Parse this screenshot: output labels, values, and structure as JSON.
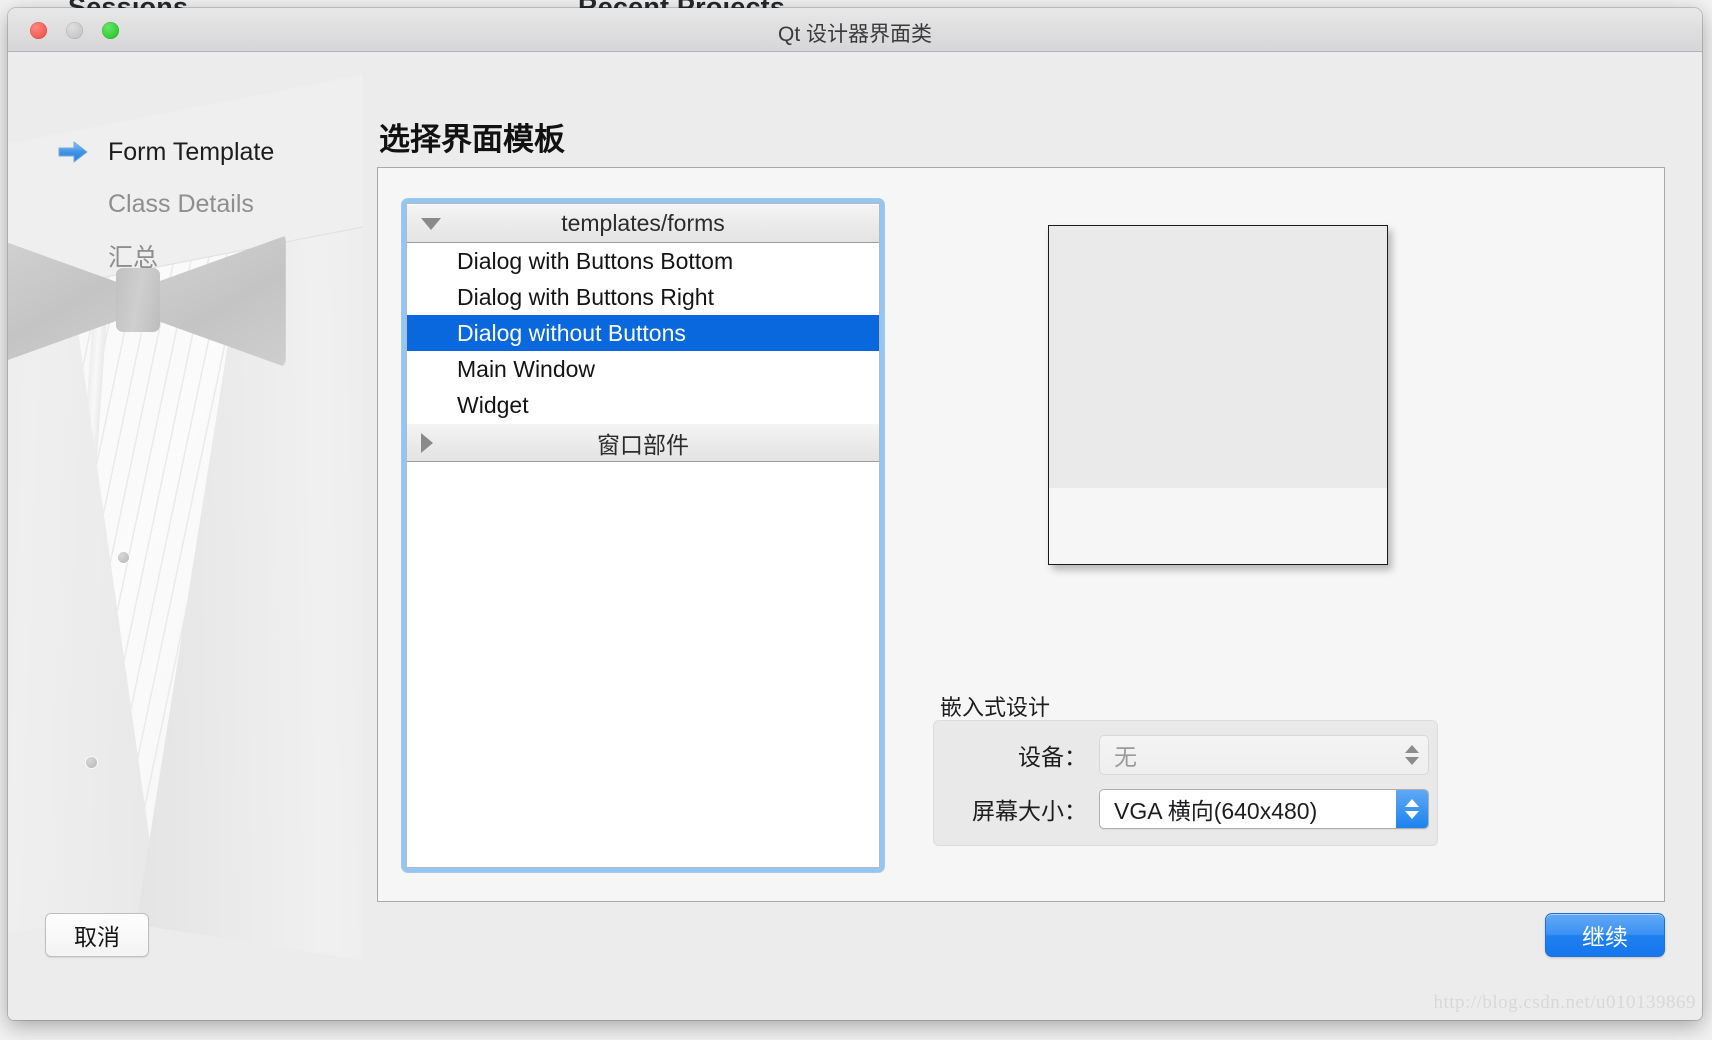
{
  "backdrop": {
    "left_heading": "Sessions",
    "right_heading": "Recent Projects"
  },
  "window": {
    "title": "Qt 设计器界面类",
    "traffic_lights": {
      "close": "close-button",
      "minimize": "minimize-button",
      "maximize": "maximize-button"
    }
  },
  "sidebar": {
    "steps": [
      {
        "label": "Form Template",
        "active": true
      },
      {
        "label": "Class Details",
        "active": false
      },
      {
        "label": "汇总",
        "active": false
      }
    ]
  },
  "page": {
    "title": "选择界面模板"
  },
  "template_list": {
    "groups": [
      {
        "name": "templates/forms",
        "expanded": true,
        "items": [
          {
            "label": "Dialog with Buttons Bottom",
            "selected": false
          },
          {
            "label": "Dialog with Buttons Right",
            "selected": false
          },
          {
            "label": "Dialog without Buttons",
            "selected": true
          },
          {
            "label": "Main Window",
            "selected": false
          },
          {
            "label": "Widget",
            "selected": false
          }
        ]
      },
      {
        "name": "窗口部件",
        "expanded": false,
        "items": []
      }
    ]
  },
  "preview": {
    "caption": "form-preview"
  },
  "embedded_design": {
    "group_label": "嵌入式设计",
    "device": {
      "label": "设备：",
      "value": "无",
      "enabled": false
    },
    "screen_size": {
      "label": "屏幕大小：",
      "value": "VGA 横向(640x480)",
      "enabled": true
    }
  },
  "footer": {
    "cancel_label": "取消",
    "continue_label": "继续"
  },
  "watermark": {
    "text": "http://blog.csdn.net/u010139869"
  },
  "colors": {
    "selection_blue": "#0a68de",
    "accent_button": "#1f80f0",
    "focus_ring": "#93c5f5",
    "window_chrome": "#ececec"
  }
}
